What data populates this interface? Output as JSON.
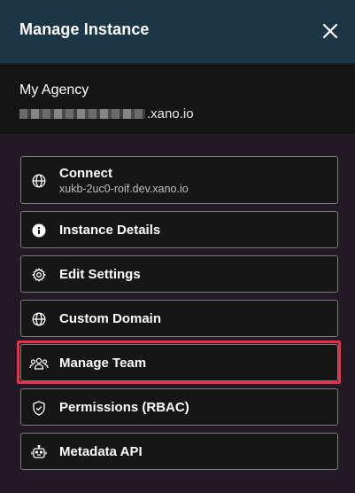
{
  "header": {
    "title": "Manage Instance",
    "close_icon": "close-icon"
  },
  "instance": {
    "name": "My Agency",
    "domain_suffix": ".xano.io"
  },
  "menu": {
    "items": [
      {
        "label": "Connect",
        "sublabel": "xukb-2uc0-roif.dev.xano.io",
        "icon": "globe-icon"
      },
      {
        "label": "Instance Details",
        "icon": "info-circle-icon"
      },
      {
        "label": "Edit Settings",
        "icon": "gear-icon"
      },
      {
        "label": "Custom Domain",
        "icon": "globe-icon"
      },
      {
        "label": "Manage Team",
        "icon": "users-icon",
        "highlighted": true
      },
      {
        "label": "Permissions (RBAC)",
        "icon": "shield-check-icon"
      },
      {
        "label": "Metadata API",
        "icon": "robot-icon"
      }
    ]
  },
  "colors": {
    "header_bg": "#1c3645",
    "highlight": "#ee2e45",
    "item_border": "#7a7a7a"
  }
}
